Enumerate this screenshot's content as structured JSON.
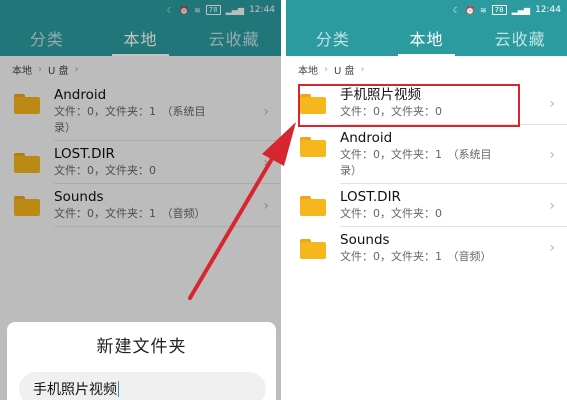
{
  "status_bar": {
    "time": "12:44",
    "battery": "78"
  },
  "tabs": [
    "分类",
    "本地",
    "云收藏"
  ],
  "breadcrumb": [
    "本地",
    "U 盘"
  ],
  "left_panel": {
    "items": [
      {
        "name": "Android",
        "meta_line1": "文件：0，文件夹：1　（系统目",
        "meta_line2": "录）"
      },
      {
        "name": "LOST.DIR",
        "meta_line1": "文件：0，文件夹：0",
        "meta_line2": ""
      },
      {
        "name": "Sounds",
        "meta_line1": "文件：0，文件夹：1　（音频）",
        "meta_line2": ""
      }
    ],
    "dialog": {
      "title": "新建文件夹",
      "input_value": "手机照片视频"
    }
  },
  "right_panel": {
    "items": [
      {
        "name": "手机照片视频",
        "meta_line1": "文件：0，文件夹：0",
        "meta_line2": ""
      },
      {
        "name": "Android",
        "meta_line1": "文件：0，文件夹：1　（系统目",
        "meta_line2": "录）"
      },
      {
        "name": "LOST.DIR",
        "meta_line1": "文件：0，文件夹：0",
        "meta_line2": ""
      },
      {
        "name": "Sounds",
        "meta_line1": "文件：0，文件夹：1　（音频）",
        "meta_line2": ""
      }
    ]
  },
  "colors": {
    "accent": "#2b9ba0",
    "folder": "#f6b61d",
    "annotation": "#d7262f"
  },
  "icons": [
    "folder-icon",
    "chevron-right-icon",
    "wifi-icon",
    "signal-icon",
    "alarm-icon",
    "moon-icon",
    "battery-icon"
  ]
}
